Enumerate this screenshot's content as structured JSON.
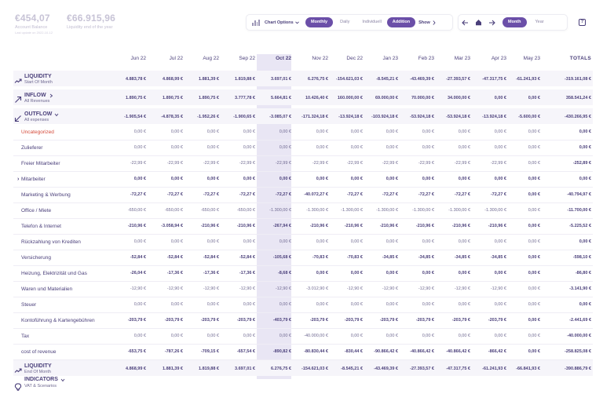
{
  "header": {
    "balance_value": "€454,07",
    "balance_label": "Account Balance",
    "balance_sub": "Last update on 2022-10-12",
    "liquidity_value": "€66.915,96",
    "liquidity_label": "Liquidity end of the year"
  },
  "toolbar": {
    "chart_options": "Chart Options",
    "monthly": "Monthly",
    "daily": "Daily",
    "individual": "Individuell",
    "addition": "Addition",
    "show": "Show"
  },
  "nav": {
    "month": "Month",
    "year": "Year",
    "help": "?"
  },
  "months": [
    "Jun 22",
    "Jul 22",
    "Aug 22",
    "Sep 22",
    "Oct 22",
    "Nov 22",
    "Dec 22",
    "Jan 23",
    "Feb 23",
    "Mar 23",
    "Apr 23",
    "May 23"
  ],
  "totals_label": "TOTALS",
  "sections": {
    "liquidity_start": {
      "title": "LIQUIDITY",
      "sub": "Start Of Month"
    },
    "inflow": {
      "title": "INFLOW",
      "sub": "All Revenues"
    },
    "outflow": {
      "title": "OUTFLOW",
      "sub": "All expenses"
    },
    "liquidity_end": {
      "title": "LIQUIDITY",
      "sub": "End Of Month"
    },
    "indicators": {
      "title": "INDICATORS",
      "sub": "VAT & Scenarios"
    }
  },
  "rows": [
    {
      "key": "liquidity_start",
      "bold": true,
      "values": [
        "4.883,78 €",
        "4.868,99 €",
        "1.881,39 €",
        "1.819,88 €",
        "3.697,01 €",
        "6.276,75 €",
        "-154.621,03 €",
        "-8.545,21 €",
        "-43.469,39 €",
        "-27.393,57 €",
        "-47.317,75 €",
        "-61.241,93 €"
      ],
      "total": "-319.161,08 €"
    },
    {
      "key": "inflow",
      "bold": true,
      "values": [
        "1.890,75 €",
        "1.890,75 €",
        "1.890,75 €",
        "3.777,78 €",
        "5.664,81 €",
        "10.426,40 €",
        "160.000,00 €",
        "69.000,00 €",
        "70.000,00 €",
        "34.000,00 €",
        "0,00 €",
        "0,00 €"
      ],
      "total": "358.541,24 €"
    },
    {
      "key": "outflow",
      "bold": true,
      "values": [
        "-1.905,54 €",
        "-4.878,35 €",
        "-1.952,26 €",
        "-1.900,65 €",
        "-3.085,07 €",
        "-171.324,18 €",
        "-13.924,18 €",
        "-103.924,18 €",
        "-53.924,18 €",
        "-53.924,18 €",
        "-13.924,18 €",
        "-5.600,00 €"
      ],
      "total": "-430.266,95 €"
    },
    {
      "label": "Uncategorized",
      "red": true,
      "bold": false,
      "values": [
        "0,00 €",
        "0,00 €",
        "0,00 €",
        "0,00 €",
        "0,00 €",
        "0,00 €",
        "0,00 €",
        "0,00 €",
        "0,00 €",
        "0,00 €",
        "0,00 €",
        "0,00 €"
      ],
      "total": "0,00 €"
    },
    {
      "label": "Zulieferer",
      "bold": false,
      "values": [
        "0,00 €",
        "0,00 €",
        "0,00 €",
        "0,00 €",
        "0,00 €",
        "0,00 €",
        "0,00 €",
        "0,00 €",
        "0,00 €",
        "0,00 €",
        "0,00 €",
        "0,00 €"
      ],
      "total": "0,00 €"
    },
    {
      "label": "Freier Mitarbeiter",
      "bold": false,
      "values": [
        "-22,99 €",
        "-22,99 €",
        "-22,99 €",
        "-22,99 €",
        "-22,99 €",
        "-22,99 €",
        "-22,99 €",
        "-22,99 €",
        "-22,99 €",
        "-22,99 €",
        "-22,99 €",
        "0,00 €"
      ],
      "total": "-252,89 €"
    },
    {
      "label": "Mitarbeiter",
      "expand": true,
      "bold": true,
      "values": [
        "0,00 €",
        "0,00 €",
        "0,00 €",
        "0,00 €",
        "0,00 €",
        "0,00 €",
        "0,00 €",
        "0,00 €",
        "0,00 €",
        "0,00 €",
        "0,00 €",
        "0,00 €"
      ],
      "total": "0,00 €"
    },
    {
      "label": "Marketing & Werbung",
      "bold": true,
      "values": [
        "-72,27 €",
        "-72,27 €",
        "-72,27 €",
        "-72,27 €",
        "-72,27 €",
        "-40.072,27 €",
        "-72,27 €",
        "-72,27 €",
        "-72,27 €",
        "-72,27 €",
        "-72,27 €",
        "0,00 €"
      ],
      "total": "-40.794,97 €"
    },
    {
      "label": "Office / Miete",
      "bold": false,
      "values": [
        "-650,00 €",
        "-650,00 €",
        "-650,00 €",
        "-650,00 €",
        "-1.300,00 €",
        "-1.300,00 €",
        "-1.300,00 €",
        "-1.300,00 €",
        "-1.300,00 €",
        "-1.300,00 €",
        "-1.300,00 €",
        "0,00 €"
      ],
      "total": "-11.700,00 €"
    },
    {
      "label": "Telefon & Internet",
      "bold": true,
      "values": [
        "-210,96 €",
        "-3.058,94 €",
        "-210,96 €",
        "-210,96 €",
        "-267,94 €",
        "-210,96 €",
        "-210,96 €",
        "-210,96 €",
        "-210,96 €",
        "-210,96 €",
        "-210,96 €",
        "0,00 €"
      ],
      "total": "-5.225,52 €"
    },
    {
      "label": "Rückzahlung von Krediten",
      "bold": false,
      "values": [
        "0,00 €",
        "0,00 €",
        "0,00 €",
        "0,00 €",
        "0,00 €",
        "0,00 €",
        "0,00 €",
        "0,00 €",
        "0,00 €",
        "0,00 €",
        "0,00 €",
        "0,00 €"
      ],
      "total": "0,00 €"
    },
    {
      "label": "Versicherung",
      "bold": true,
      "values": [
        "-52,84 €",
        "-52,84 €",
        "-52,84 €",
        "-52,84 €",
        "-105,68 €",
        "-70,83 €",
        "-70,83 €",
        "-34,85 €",
        "-34,85 €",
        "-34,85 €",
        "-34,85 €",
        "0,00 €"
      ],
      "total": "-598,10 €"
    },
    {
      "label": "Heizung, Elektrizität und Gas",
      "bold": true,
      "values": [
        "-26,04 €",
        "-17,36 €",
        "-17,36 €",
        "-17,36 €",
        "-8,68 €",
        "0,00 €",
        "0,00 €",
        "0,00 €",
        "0,00 €",
        "0,00 €",
        "0,00 €",
        "0,00 €"
      ],
      "total": "-86,80 €"
    },
    {
      "label": "Waren und Materialien",
      "bold": false,
      "values": [
        "-12,90 €",
        "-12,90 €",
        "-12,90 €",
        "-12,90 €",
        "-12,90 €",
        "-3.012,90 €",
        "-12,90 €",
        "-12,90 €",
        "-12,90 €",
        "-12,90 €",
        "-12,90 €",
        "0,00 €"
      ],
      "total": "-3.141,90 €"
    },
    {
      "label": "Steuer",
      "bold": false,
      "values": [
        "0,00 €",
        "0,00 €",
        "0,00 €",
        "0,00 €",
        "0,00 €",
        "0,00 €",
        "0,00 €",
        "0,00 €",
        "0,00 €",
        "0,00 €",
        "0,00 €",
        "0,00 €"
      ],
      "total": "0,00 €"
    },
    {
      "label": "Kontoführung & Kartengebühren",
      "bold": true,
      "values": [
        "-203,79 €",
        "-203,79 €",
        "-203,79 €",
        "-203,79 €",
        "-403,79 €",
        "-203,79 €",
        "-203,79 €",
        "-203,79 €",
        "-203,79 €",
        "-203,79 €",
        "-203,79 €",
        "0,00 €"
      ],
      "total": "-2.441,69 €"
    },
    {
      "label": "Tax",
      "bold": false,
      "values": [
        "0,00 €",
        "0,00 €",
        "0,00 €",
        "0,00 €",
        "0,00 €",
        "-40.000,00 €",
        "0,00 €",
        "0,00 €",
        "0,00 €",
        "0,00 €",
        "0,00 €",
        "0,00 €"
      ],
      "total": "-40.000,00 €"
    },
    {
      "label": "cost of revenue",
      "bold": true,
      "values": [
        "-653,75 €",
        "-787,26 €",
        "-709,15 €",
        "-657,54 €",
        "-890,82 €",
        "-80.830,44 €",
        "-830,44 €",
        "-90.866,42 €",
        "-40.866,42 €",
        "-40.866,42 €",
        "-866,42 €",
        "0,00 €"
      ],
      "total": "-258.825,08 €"
    },
    {
      "key": "liquidity_end",
      "bold": true,
      "values": [
        "4.868,99 €",
        "1.881,39 €",
        "1.819,88 €",
        "3.697,01 €",
        "6.276,75 €",
        "-154.621,03 €",
        "-8.545,21 €",
        "-43.469,39 €",
        "-27.393,57 €",
        "-47.317,75 €",
        "-61.241,93 €",
        "-66.841,93 €"
      ],
      "total": "-390.886,79 €"
    }
  ]
}
